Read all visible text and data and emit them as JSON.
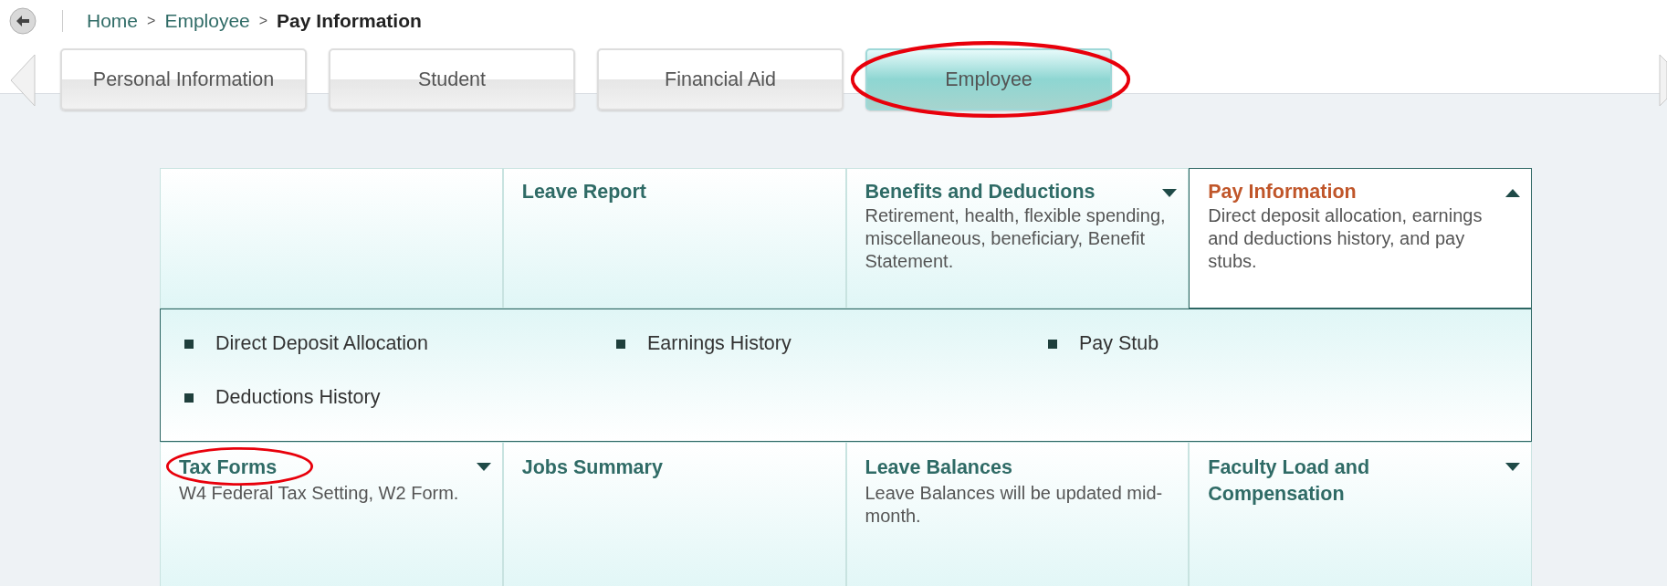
{
  "breadcrumb": [
    {
      "label": "Home",
      "current": false
    },
    {
      "label": "Employee",
      "current": false
    },
    {
      "label": "Pay Information",
      "current": true
    }
  ],
  "breadcrumb_separator": ">",
  "tabs": [
    {
      "label": "Personal Information",
      "selected": false,
      "highlighted": false
    },
    {
      "label": "Student",
      "selected": false,
      "highlighted": false
    },
    {
      "label": "Financial Aid",
      "selected": false,
      "highlighted": false
    },
    {
      "label": "Employee",
      "selected": true,
      "highlighted": true
    }
  ],
  "cards_top": [
    {
      "expandable": false,
      "selected": false,
      "highlighted": false
    },
    {
      "title": "Leave Report",
      "expandable": false,
      "selected": false,
      "highlighted": false
    },
    {
      "title": "Benefits and Deductions",
      "description": "Retirement, health, flexible spending, miscellaneous, beneficiary, Benefit Statement.",
      "expandable": true,
      "expanded": false,
      "selected": false,
      "highlighted": false
    },
    {
      "title": "Pay Information",
      "description": "Direct deposit allocation, earnings and deductions history, and pay stubs.",
      "expandable": true,
      "expanded": true,
      "selected": true,
      "highlighted": false
    }
  ],
  "submenu": [
    "Direct Deposit Allocation",
    "Earnings History",
    "Pay Stub",
    "Deductions History"
  ],
  "cards_bottom": [
    {
      "title": "Tax Forms",
      "description": "W4 Federal Tax Setting, W2 Form.",
      "expandable": true,
      "expanded": false,
      "selected": false,
      "highlighted": true
    },
    {
      "title": "Jobs Summary",
      "expandable": false,
      "selected": false,
      "highlighted": false
    },
    {
      "title": "Leave Balances",
      "description": "Leave Balances will be updated mid-month.",
      "expandable": false,
      "selected": false,
      "highlighted": false
    },
    {
      "title": "Faculty Load and Compensation",
      "expandable": true,
      "expanded": false,
      "selected": false,
      "highlighted": false
    }
  ]
}
